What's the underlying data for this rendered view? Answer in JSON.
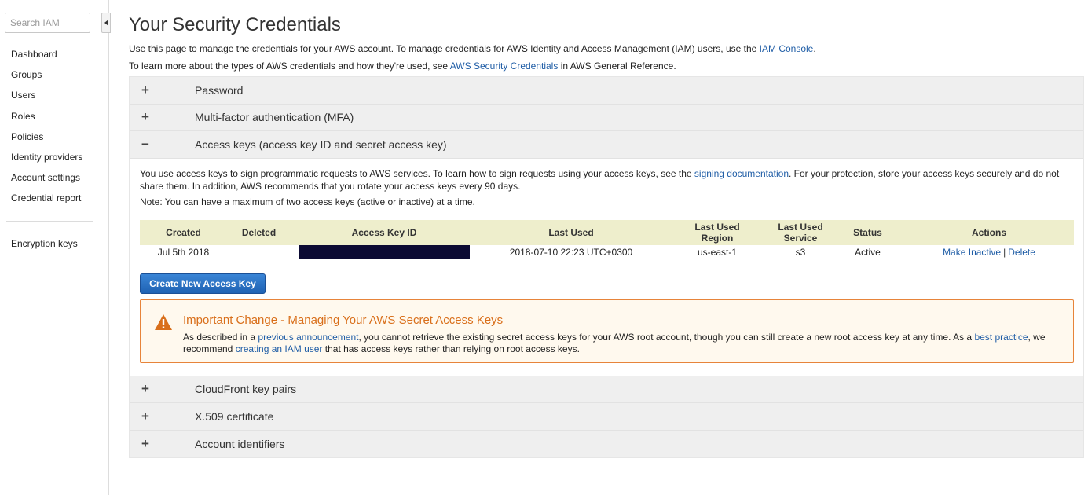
{
  "sidebar": {
    "search_placeholder": "Search IAM",
    "items": [
      {
        "label": "Dashboard"
      },
      {
        "label": "Groups"
      },
      {
        "label": "Users"
      },
      {
        "label": "Roles"
      },
      {
        "label": "Policies"
      },
      {
        "label": "Identity providers"
      },
      {
        "label": "Account settings"
      },
      {
        "label": "Credential report"
      }
    ],
    "secondary_items": [
      {
        "label": "Encryption keys"
      }
    ]
  },
  "page": {
    "title": "Your Security Credentials",
    "intro1_text": "Use this page to manage the credentials for your AWS account. To manage credentials for AWS Identity and Access Management (IAM) users, use the",
    "intro1_link": "IAM Console",
    "intro1_end": ".",
    "intro2_text": "To learn more about the types of AWS credentials and how they're used, see",
    "intro2_link": "AWS Security Credentials",
    "intro2_end": "in AWS General Reference."
  },
  "accordion": {
    "collapsed_sign": "+",
    "expanded_sign": "−",
    "sections_top": [
      {
        "title": "Password"
      },
      {
        "title": "Multi-factor authentication (MFA)"
      }
    ],
    "expanded": {
      "title": "Access keys (access key ID and secret access key)",
      "body_p1_a": "You use access keys to sign programmatic requests to AWS services. To learn how to sign requests using your access keys, see the",
      "body_p1_link": "signing documentation",
      "body_p1_b": ". For your protection, store your access keys securely and do not share them. In addition, AWS recommends that you rotate your access keys every 90 days.",
      "body_p2": "Note: You can have a maximum of two access keys (active or inactive) at a time.",
      "table": {
        "headers": {
          "created": "Created",
          "deleted": "Deleted",
          "key_id": "Access Key ID",
          "last_used": "Last Used",
          "region_l1": "Last Used",
          "region_l2": "Region",
          "service_l1": "Last Used",
          "service_l2": "Service",
          "status": "Status",
          "actions": "Actions"
        },
        "rows": [
          {
            "created": "Jul 5th 2018",
            "deleted": "",
            "last_used": "2018-07-10 22:23 UTC+0300",
            "region": "us-east-1",
            "service": "s3",
            "status": "Active",
            "action1": "Make Inactive",
            "separator": "|",
            "action2": "Delete"
          }
        ]
      },
      "create_button": "Create New Access Key",
      "alert": {
        "title": "Important Change - Managing Your AWS Secret Access Keys",
        "t1": "As described in a",
        "l1": "previous announcement",
        "t2": ", you cannot retrieve the existing secret access keys for your AWS root account, though you can still create a new root access key at any time. As a",
        "l2": "best practice",
        "t3": ", we recommend",
        "l3": "creating an IAM user",
        "t4": "that has access keys rather than relying on root access keys.",
        "icon": "warning-icon",
        "icon_color": "#d96f1b"
      }
    },
    "sections_bottom": [
      {
        "title": "CloudFront key pairs"
      },
      {
        "title": "X.509 certificate"
      },
      {
        "title": "Account identifiers"
      }
    ]
  },
  "colors": {
    "link": "#1f5da6",
    "table_header_bg": "#eeeecc",
    "alert_border": "#e7843a",
    "button_bg": "#2a73c6"
  }
}
